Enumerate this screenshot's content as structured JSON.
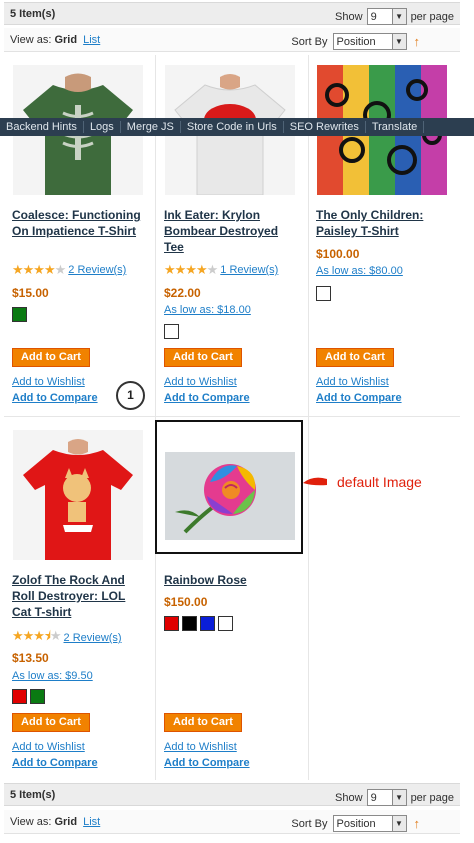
{
  "toolbar_top": {
    "item_count": "5 Item(s)",
    "show_label": "Show",
    "per_page_value": "9",
    "per_page_label": "per page",
    "view_as_label": "View as:",
    "view_grid": "Grid",
    "view_list": "List",
    "sort_by_label": "Sort By",
    "sort_value": "Position",
    "sort_direction_icon": "arrow-up-icon"
  },
  "dev_toolbar": {
    "items": [
      "Backend Hints",
      "Logs",
      "Merge JS",
      "Store Code in Urls",
      "SEO Rewrites",
      "Translate"
    ]
  },
  "products": [
    {
      "name": "Coalesce: Functioning On Impatience T-Shirt",
      "rating": 4,
      "rating_max": 5,
      "reviews": "2 Review(s)",
      "price": "$15.00",
      "as_low_as": "",
      "swatches": [
        "#0a7a12"
      ],
      "add_to_cart": "Add to Cart",
      "add_to_wishlist": "Add to Wishlist",
      "add_to_compare": "Add to Compare"
    },
    {
      "name": "Ink Eater: Krylon Bombear Destroyed Tee",
      "rating": 4,
      "rating_max": 5,
      "reviews": "1 Review(s)",
      "price": "$22.00",
      "as_low_as": "As low as: $18.00",
      "swatches": [
        "#ffffff"
      ],
      "add_to_cart": "Add to Cart",
      "add_to_wishlist": "Add to Wishlist",
      "add_to_compare": "Add to Compare"
    },
    {
      "name": "The Only Children: Paisley T-Shirt",
      "rating": 0,
      "rating_max": 5,
      "reviews": "",
      "price": "$100.00",
      "as_low_as": "As low as: $80.00",
      "swatches": [
        "#ffffff"
      ],
      "add_to_cart": "Add to Cart",
      "add_to_wishlist": "Add to Wishlist",
      "add_to_compare": "Add to Compare"
    },
    {
      "name": "Zolof The Rock And Roll Destroyer: LOL Cat T-shirt",
      "rating": 3.5,
      "rating_max": 5,
      "reviews": "2 Review(s)",
      "price": "$13.50",
      "as_low_as": "As low as: $9.50",
      "swatches": [
        "#e00000",
        "#0a7a12"
      ],
      "add_to_cart": "Add to Cart",
      "add_to_wishlist": "Add to Wishlist",
      "add_to_compare": "Add to Compare"
    },
    {
      "name": "Rainbow Rose",
      "rating": 0,
      "rating_max": 5,
      "reviews": "",
      "price": "$150.00",
      "as_low_as": "",
      "swatches": [
        "#e00000",
        "#000000",
        "#0a1ed8",
        "#ffffff"
      ],
      "add_to_cart": "Add to Cart",
      "add_to_wishlist": "Add to Wishlist",
      "add_to_compare": "Add to Compare"
    }
  ],
  "annotations": {
    "marker_number": "1",
    "default_image_label": "default Image"
  },
  "toolbar_bottom": {
    "item_count": "5 Item(s)",
    "show_label": "Show",
    "per_page_value": "9",
    "per_page_label": "per page",
    "view_as_label": "View as:",
    "view_grid": "Grid",
    "view_list": "List",
    "sort_by_label": "Sort By",
    "sort_value": "Position"
  },
  "colors": {
    "price": "#c76200",
    "link": "#1e7ec8",
    "cart_button": "#f18200",
    "annotation": "#e0200c"
  }
}
